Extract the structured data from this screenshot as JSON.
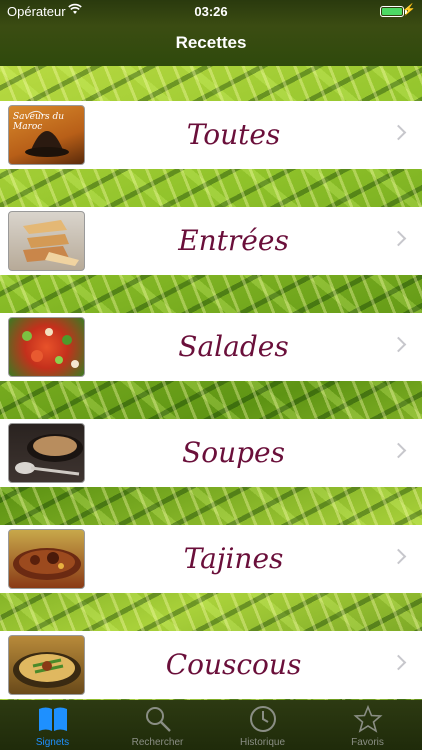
{
  "status": {
    "carrier": "Opérateur",
    "time": "03:26",
    "battery_level": 1.0,
    "battery_color": "#4cd964"
  },
  "nav": {
    "title": "Recettes"
  },
  "rows": [
    {
      "label": "Toutes",
      "thumb_icon": "tajine-logo-icon",
      "thumb_text": "Saveurs du Maroc"
    },
    {
      "label": "Entrées",
      "thumb_icon": "pastry-icon"
    },
    {
      "label": "Salades",
      "thumb_icon": "salad-icon"
    },
    {
      "label": "Soupes",
      "thumb_icon": "soup-icon"
    },
    {
      "label": "Tajines",
      "thumb_icon": "tajine-icon"
    },
    {
      "label": "Couscous",
      "thumb_icon": "couscous-icon"
    }
  ],
  "tabs": [
    {
      "label": "Signets",
      "icon": "book-icon",
      "active": true
    },
    {
      "label": "Rechercher",
      "icon": "search-icon",
      "active": false
    },
    {
      "label": "Historique",
      "icon": "clock-icon",
      "active": false
    },
    {
      "label": "Favoris",
      "icon": "star-icon",
      "active": false
    }
  ],
  "colors": {
    "accent": "#1e90ff",
    "label": "#6a0f3a",
    "tab_inactive": "#8a8e84"
  }
}
